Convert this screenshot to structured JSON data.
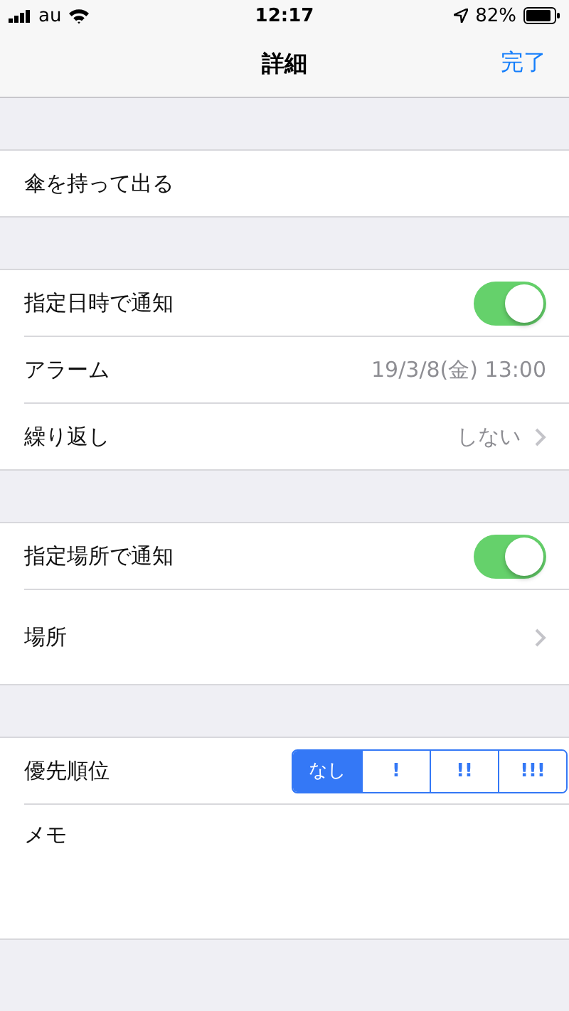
{
  "status_bar": {
    "carrier": "au",
    "time": "12:17",
    "battery": "82%"
  },
  "nav": {
    "title": "詳細",
    "done": "完了"
  },
  "sections": [
    {
      "rows": [
        {
          "kind": "text",
          "label": "傘を持って出る"
        }
      ]
    },
    {
      "rows": [
        {
          "kind": "toggle",
          "label": "指定日時で通知",
          "on": true
        },
        {
          "kind": "value",
          "label": "アラーム",
          "value": "19/3/8(金) 13:00"
        },
        {
          "kind": "chevron",
          "label": "繰り返し",
          "value": "しない"
        }
      ]
    },
    {
      "rows": [
        {
          "kind": "toggle",
          "label": "指定場所で通知",
          "on": true
        },
        {
          "kind": "chevron",
          "label": "場所"
        }
      ]
    },
    {
      "rows": [
        {
          "kind": "segmented",
          "label": "優先順位",
          "options": [
            {
              "label": "なし",
              "selected": true
            },
            {
              "label": "!",
              "selected": false
            },
            {
              "label": "!!",
              "selected": false
            },
            {
              "label": "!!!",
              "selected": false
            }
          ]
        },
        {
          "kind": "memo",
          "label": "メモ"
        }
      ]
    }
  ]
}
